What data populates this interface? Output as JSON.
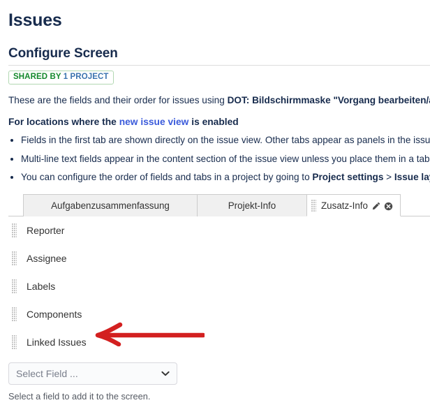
{
  "header": {
    "page_title": "Issues",
    "section_title": "Configure Screen"
  },
  "badge": {
    "shared_label": "SHARED BY",
    "shared_link": "1 PROJECT"
  },
  "description": {
    "intro_prefix": "These are the fields and their order for issues using ",
    "intro_screen_name": "DOT: Bildschirmmaske \"Vorgang bearbeiten/anzeig",
    "subhead_prefix": "For locations where the ",
    "subhead_link": "new issue view",
    "subhead_suffix": " is enabled",
    "bullets": [
      {
        "text_a": "Fields in the first tab are shown directly on the issue view. Other tabs appear as panels in the issue deta",
        "bold_a": "",
        "text_b": ""
      },
      {
        "text_a": "Multi-line text fields appear in the content section of the issue view unless you place them in a tab.",
        "bold_a": "",
        "text_b": ""
      },
      {
        "text_a": "You can configure the order of fields and tabs in a project by going to ",
        "bold_a": "Project settings",
        "text_b": " > ",
        "bold_b": "Issue layout"
      }
    ]
  },
  "tabs": [
    {
      "label": "Aufgabenzusammenfassung",
      "active": false
    },
    {
      "label": "Projekt-Info",
      "active": false
    },
    {
      "label": "Zusatz-Info",
      "active": true
    }
  ],
  "tab_icons": {
    "edit": "pencil-icon",
    "remove": "close-circle-icon",
    "grip": "drag-handle-icon"
  },
  "fields": [
    {
      "label": "Reporter"
    },
    {
      "label": "Assignee"
    },
    {
      "label": "Labels"
    },
    {
      "label": "Components"
    },
    {
      "label": "Linked Issues"
    }
  ],
  "add_field": {
    "placeholder": "Select Field ...",
    "hint": "Select a field to add it to the screen.",
    "caret_icon": "chevron-down-icon"
  },
  "annotation": {
    "type": "arrow",
    "color": "#d32020",
    "points_to": "Linked Issues",
    "direction": "left"
  },
  "colors": {
    "text": "#172b4d",
    "link": "#3b5bdb",
    "badge_green": "#14892c",
    "badge_link_blue": "#3b73af",
    "tab_inactive_bg": "#f0f0f0",
    "tab_border": "#cccccc",
    "annotation_red": "#d32020"
  }
}
